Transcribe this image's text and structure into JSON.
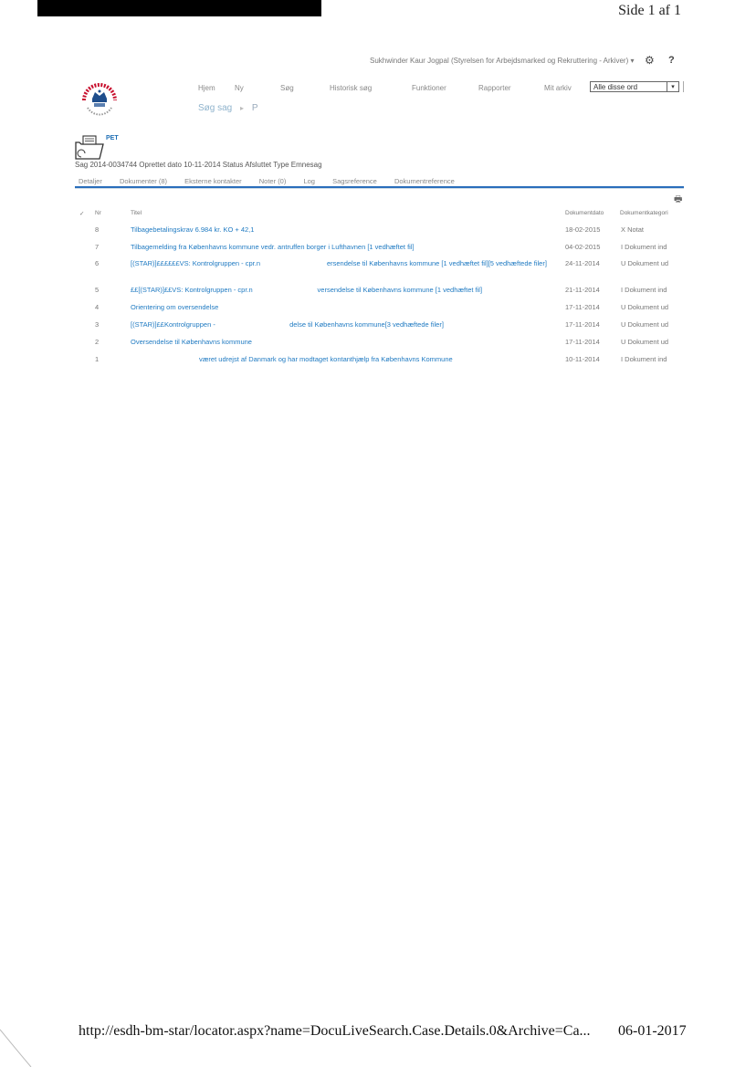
{
  "page": {
    "page_number": "Side 1 af 1",
    "footer_url": "http://esdh-bm-star/locator.aspx?name=DocuLiveSearch.Case.Details.0&Archive=Ca...",
    "footer_date": "06-01-2017"
  },
  "header": {
    "user": "Sukhwinder Kaur Jogpal (Styrelsen for Arbejdsmarked og Rekruttering - Arkiver) ▾",
    "gear_glyph": "⚙",
    "help_glyph": "?"
  },
  "nav": {
    "items": [
      "Hjem",
      "Ny",
      "Søg",
      "Historisk søg",
      "Funktioner",
      "Rapporter",
      "Mit arkiv"
    ],
    "search_value": "Alle disse ord",
    "search_dropdown_glyph": "▾"
  },
  "breadcrumb": {
    "link": "Søg sag",
    "separator": "▸",
    "current": "P"
  },
  "case": {
    "icon_label": "PET",
    "info": "Sag 2014-0034744   Oprettet dato 10-11-2014   Status Afsluttet   Type Emnesag"
  },
  "tabs": [
    "Detaljer",
    "Dokumenter (8)",
    "Eksterne kontakter",
    "Noter (0)",
    "Log",
    "Sagsreference",
    "Dokumentreference"
  ],
  "table": {
    "headers": {
      "check": "✓",
      "nr": "Nr",
      "title": "Titel",
      "date": "Dokumentdato",
      "category": "Dokumentkategori"
    },
    "print_glyph": "🖶",
    "rows": [
      {
        "nr": "8",
        "title": "Tilbagebetalingskrav 6.984 kr. KO + 42,1",
        "date": "18-02-2015",
        "category": "X   Notat"
      },
      {
        "nr": "7",
        "title": "Tilbagemelding fra Københavns kommune vedr. antruffen borger i Lufthavnen [1 vedhæftet fil]",
        "date": "04-02-2015",
        "category": "I   Dokument ind"
      },
      {
        "nr": "6",
        "title": "[(STAR)]££££££VS: Kontrolgruppen - cpr.n                                   ersendelse til Københavns kommune [1 vedhæftet fil][5 vedhæftede filer]",
        "date": "24-11-2014",
        "category": "U   Dokument ud"
      },
      {
        "nr": "5",
        "title": "££[(STAR)]££VS: Kontrolgruppen - cpr.n                                  versendelse til Københavns kommune [1 vedhæftet fil]",
        "date": "21-11-2014",
        "category": "I   Dokument ind"
      },
      {
        "nr": "4",
        "title": "Orientering om oversendelse",
        "date": "17-11-2014",
        "category": "U   Dokument ud"
      },
      {
        "nr": "3",
        "title": "[(STAR)]££Kontrolgruppen -                                       delse til Københavns kommune[3 vedhæftede filer]",
        "date": "17-11-2014",
        "category": "U   Dokument ud"
      },
      {
        "nr": "2",
        "title": "Oversendelse til Københavns kommune",
        "date": "17-11-2014",
        "category": "U   Dokument ud"
      },
      {
        "nr": "1",
        "title": "                                    været udrejst af Danmark og har modtaget kontanthjælp fra Københavns Kommune",
        "date": "10-11-2014",
        "category": "I   Dokument ind"
      }
    ]
  },
  "colors": {
    "accent": "#2a6ebb",
    "link": "#1f7ac2",
    "logo_red": "#c8102e"
  }
}
